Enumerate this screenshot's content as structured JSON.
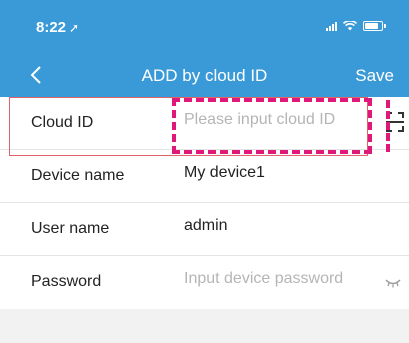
{
  "status_bar": {
    "time": "8:22",
    "location_icon": "location-arrow-icon",
    "signal_icon": "signal-icon",
    "wifi_icon": "wifi-icon",
    "battery_icon": "battery-icon"
  },
  "nav": {
    "back_icon": "chevron-left-icon",
    "title": "ADD by cloud ID",
    "save_label": "Save"
  },
  "form": {
    "cloud_id": {
      "label": "Cloud ID",
      "value": "",
      "placeholder": "Please input cloud ID",
      "action_icon": "scan-icon"
    },
    "device_name": {
      "label": "Device name",
      "value": "My device1"
    },
    "user_name": {
      "label": "User name",
      "value": "admin"
    },
    "password": {
      "label": "Password",
      "value": "",
      "placeholder": "Input device password",
      "action_icon": "eye-closed-icon"
    }
  },
  "colors": {
    "header": "#3a9ad8",
    "highlight_red": "#e0626a",
    "highlight_dashed": "#e0187a",
    "background": "#f2f2f2"
  }
}
